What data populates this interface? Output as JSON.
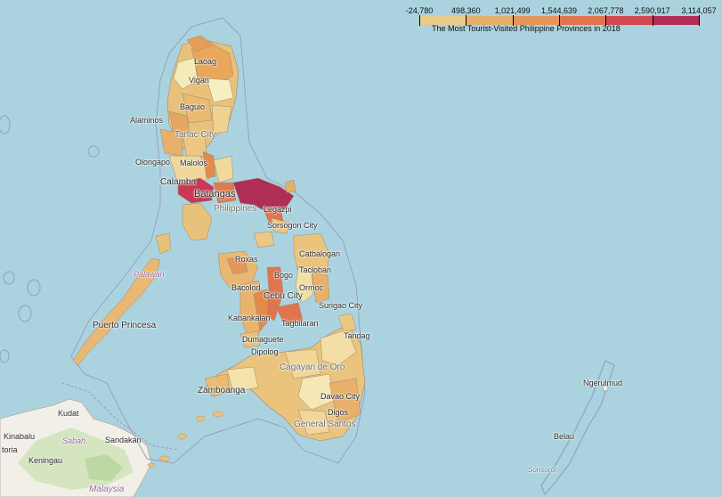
{
  "legend": {
    "caption": "The Most Tourist-Visited Philippine Provinces in 2018",
    "ticks": [
      "-24,780",
      "498,360",
      "1,021,499",
      "1,544,639",
      "2,067,778",
      "2,590,917",
      "3,114,057"
    ],
    "colors": [
      "#e8cc8a",
      "#e3b16b",
      "#e5965b",
      "#e0744f",
      "#d04a4f",
      "#b02d55"
    ]
  },
  "places": {
    "laoag": "Laoag",
    "vigan": "Vigan",
    "baguio": "Baguio",
    "alaminos": "Alaminos",
    "tarlac": "Tarlac City",
    "olongapo": "Olongapo",
    "malolos": "Malolos",
    "calamba": "Calamba",
    "batangas": "Batangas",
    "philippines": "Philippines",
    "legazpi": "Legazpi",
    "sorsogon": "Sorsogon City",
    "roxas": "Roxas",
    "bogo": "Bogo",
    "bacolod": "Bacolod",
    "cebu": "Cebu City",
    "ormoc": "Ormoc",
    "catbalogan": "Catbalogan",
    "tacloban": "Tacloban",
    "kabankalan": "Kabankalan",
    "tagbilaran": "Tagbilaran",
    "surigao": "Surigao City",
    "tandag": "Tandag",
    "dumaguete": "Dumaguete",
    "dipolog": "Dipolog",
    "cagayan": "Cagayan de Oro",
    "zamboanga": "Zamboanga",
    "davao": "Davao City",
    "digos": "Digos",
    "gensan": "General Santos",
    "puerto": "Puerto Princesa",
    "palawan": "Palawan",
    "kudat": "Kudat",
    "sabah": "Sabah",
    "sandakan": "Sandakan",
    "kinabalu": "Kinabalu",
    "keningau": "Keningau",
    "toria": "toria",
    "malaysia": "Malaysia",
    "ngerulmud": "Ngerulmud",
    "belau": "Belau",
    "sonsorol": "Sonsorol"
  }
}
